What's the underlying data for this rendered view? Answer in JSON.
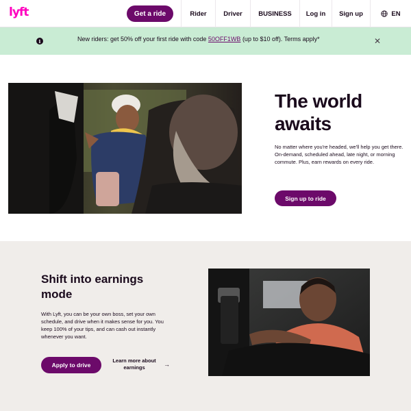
{
  "header": {
    "logo": "lyft",
    "get_ride_label": "Get a ride",
    "nav": [
      {
        "label": "Rider"
      },
      {
        "label": "Driver"
      },
      {
        "label": "BUSINESS"
      },
      {
        "label": "Log in"
      },
      {
        "label": "Sign up"
      }
    ],
    "language": "EN"
  },
  "banner": {
    "text_before": "New riders: get 50% off your first ride with code ",
    "promo_code": "50OFF1WB",
    "text_after": " (up to $10 off). Terms apply*",
    "info_icon": "info-icon",
    "close_icon": "close-icon"
  },
  "hero": {
    "title": "The world awaits",
    "body": "No matter where you're headed, we'll help you get there. On-demand, scheduled ahead, late night, or morning commute. Plus, earn rewards on every ride.",
    "cta": "Sign up to ride"
  },
  "driver": {
    "title": "Shift into earnings mode",
    "body": "With Lyft, you can be your own boss, set your own schedule, and drive when it makes sense for you. You keep 100% of your tips, and can cash out instantly whenever you want.",
    "apply_label": "Apply to drive",
    "learn_more_label": "Learn more about earnings"
  },
  "colors": {
    "brand_pink": "#ff00bf",
    "primary_purple": "#6c0a6a",
    "banner_green": "#c9ecd4",
    "section_beige": "#f0edea"
  }
}
